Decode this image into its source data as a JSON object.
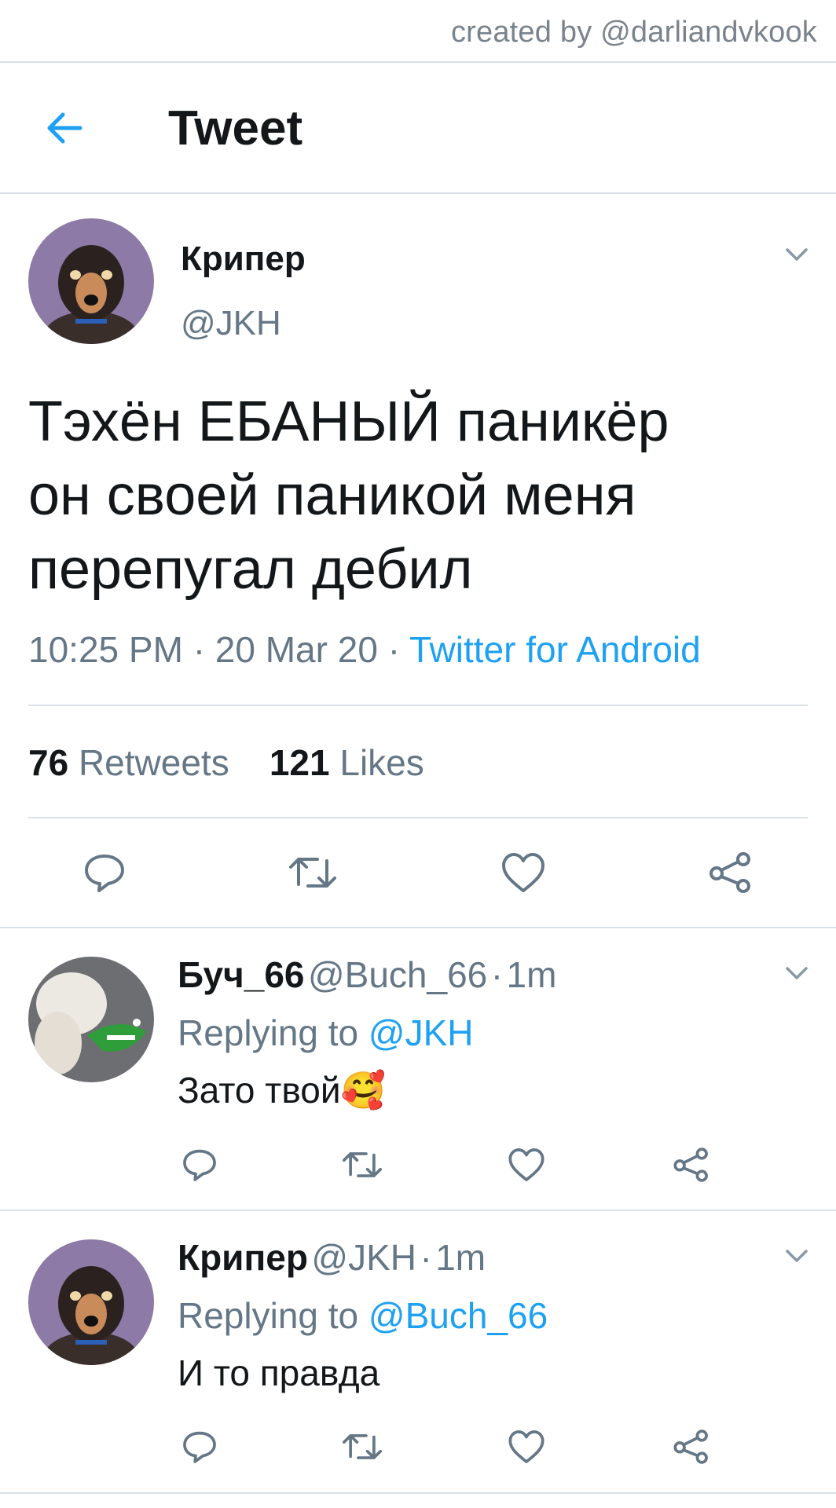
{
  "credit": "created by @darliandvkook",
  "header": {
    "title": "Tweet"
  },
  "main_tweet": {
    "author_name": "Крипер",
    "author_handle": "@JKH",
    "text_lines": [
      "Тэхён ЕБАНЫЙ паникёр",
      "он своей паникой меня",
      "перепугал дебил"
    ],
    "time": "10:25 PM",
    "date": "20 Mar 20",
    "source": "Twitter for Android",
    "retweets_count": "76",
    "retweets_label": "Retweets",
    "likes_count": "121",
    "likes_label": "Likes"
  },
  "replies": [
    {
      "author_name": "Буч_66",
      "author_handle": "@Buch_66",
      "time_ago": "1m",
      "replying_prefix": "Replying to",
      "replying_to": "@JKH",
      "text": "Зато твой🥰"
    },
    {
      "author_name": "Крипер",
      "author_handle": "@JKH",
      "time_ago": "1m",
      "replying_prefix": "Replying to",
      "replying_to": "@Buch_66",
      "text": "И то правда"
    }
  ],
  "separator": "·",
  "icons": [
    "back-arrow-icon",
    "chevron-down-icon",
    "reply-icon",
    "retweet-icon",
    "like-icon",
    "share-icon"
  ],
  "colors": {
    "accent": "#1da1f2",
    "muted": "#657786",
    "divider": "#dbe1e6"
  }
}
